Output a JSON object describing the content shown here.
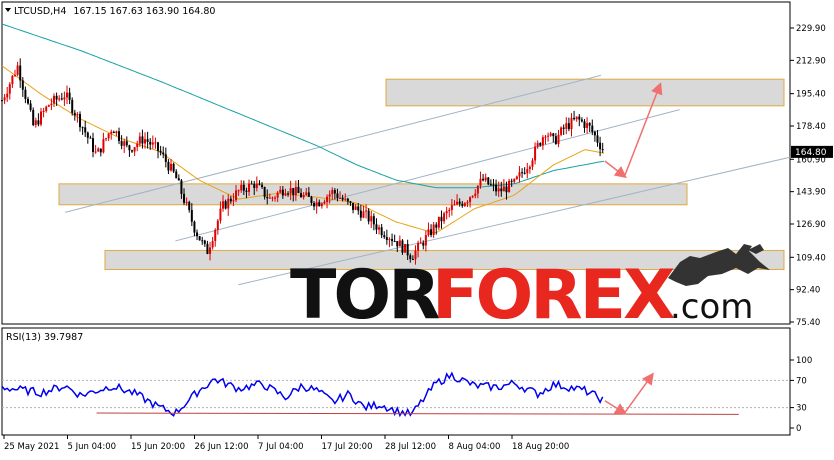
{
  "header": {
    "symbol": "LTCUSD,H4",
    "ohlc": "167.15 167.63 163.90 164.80"
  },
  "indicator": {
    "label": "RSI(13) 39.7987"
  },
  "watermark": {
    "tor": "TOR",
    "forex": "FOREX",
    "com": ".com"
  },
  "colors": {
    "bull": "#e00000",
    "bear": "#000000",
    "ma_fast": "#e8a317",
    "ma_slow": "#1aa3a3",
    "rsi": "#0000ee",
    "zone_fill": "#d9d9d9",
    "zone_border": "#e0a940",
    "channel": "#9fb4c8",
    "arrow": "#f07070",
    "tag": "#000000",
    "wm_dark": "#111111",
    "wm_red": "#e8281e"
  },
  "chart_data": [
    {
      "type": "candlestick",
      "symbol": "LTCUSD",
      "timeframe": "H4",
      "y_ticks": [
        229.9,
        212.9,
        195.4,
        178.4,
        160.9,
        143.9,
        126.9,
        109.4,
        92.4,
        75.4
      ],
      "ylim": [
        75.4,
        229.9
      ],
      "current_price": 164.8,
      "x_tick_labels": [
        "25 May 2021",
        "5 Jun 04:00",
        "15 Jun 20:00",
        "26 Jun 12:00",
        "7 Jul 04:00",
        "17 Jul 20:00",
        "28 Jul 12:00",
        "8 Aug 04:00",
        "18 Aug 20:00"
      ],
      "price_path": [
        [
          0,
          192
        ],
        [
          0.02,
          210
        ],
        [
          0.04,
          178
        ],
        [
          0.06,
          190
        ],
        [
          0.08,
          195
        ],
        [
          0.1,
          180
        ],
        [
          0.12,
          163
        ],
        [
          0.14,
          178
        ],
        [
          0.16,
          166
        ],
        [
          0.18,
          172
        ],
        [
          0.2,
          165
        ],
        [
          0.22,
          152
        ],
        [
          0.245,
          124
        ],
        [
          0.26,
          112
        ],
        [
          0.28,
          136
        ],
        [
          0.3,
          144
        ],
        [
          0.32,
          148
        ],
        [
          0.34,
          140
        ],
        [
          0.36,
          146
        ],
        [
          0.38,
          142
        ],
        [
          0.4,
          138
        ],
        [
          0.42,
          144
        ],
        [
          0.44,
          137
        ],
        [
          0.46,
          132
        ],
        [
          0.48,
          124
        ],
        [
          0.5,
          118
        ],
        [
          0.52,
          110
        ],
        [
          0.535,
          118
        ],
        [
          0.55,
          126
        ],
        [
          0.57,
          135
        ],
        [
          0.59,
          140
        ],
        [
          0.61,
          150
        ],
        [
          0.63,
          144
        ],
        [
          0.65,
          148
        ],
        [
          0.67,
          160
        ],
        [
          0.69,
          176
        ],
        [
          0.7,
          170
        ],
        [
          0.715,
          178
        ],
        [
          0.73,
          182
        ],
        [
          0.745,
          178
        ],
        [
          0.76,
          168
        ],
        [
          0.765,
          164.8
        ]
      ],
      "ma_fast_path": [
        [
          0,
          210
        ],
        [
          0.05,
          195
        ],
        [
          0.1,
          182
        ],
        [
          0.15,
          172
        ],
        [
          0.2,
          165
        ],
        [
          0.25,
          150
        ],
        [
          0.3,
          140
        ],
        [
          0.35,
          143
        ],
        [
          0.4,
          141
        ],
        [
          0.45,
          138
        ],
        [
          0.5,
          128
        ],
        [
          0.55,
          122
        ],
        [
          0.6,
          135
        ],
        [
          0.65,
          142
        ],
        [
          0.7,
          158
        ],
        [
          0.74,
          166
        ],
        [
          0.765,
          164
        ]
      ],
      "ma_slow_path": [
        [
          0,
          232
        ],
        [
          0.1,
          218
        ],
        [
          0.2,
          202
        ],
        [
          0.3,
          185
        ],
        [
          0.4,
          168
        ],
        [
          0.45,
          158
        ],
        [
          0.5,
          150
        ],
        [
          0.55,
          146
        ],
        [
          0.6,
          146
        ],
        [
          0.65,
          148
        ],
        [
          0.7,
          155
        ],
        [
          0.765,
          160
        ]
      ],
      "zones": [
        {
          "from": 189,
          "to": 203
        },
        {
          "from": 137,
          "to": 148
        },
        {
          "from": 103,
          "to": 113
        }
      ],
      "trendlines": [
        {
          "from": [
            0.08,
            133
          ],
          "to": [
            0.76,
            205
          ]
        },
        {
          "from": [
            0.22,
            118
          ],
          "to": [
            0.86,
            187
          ]
        },
        {
          "from": [
            0.3,
            95
          ],
          "to": [
            1.0,
            162
          ]
        }
      ],
      "forecast_arrows": [
        {
          "from": [
            0.765,
            160
          ],
          "to": [
            0.79,
            152
          ]
        },
        {
          "from": [
            0.79,
            152
          ],
          "to": [
            0.835,
            200
          ]
        }
      ]
    },
    {
      "type": "line",
      "name": "RSI(13)",
      "y_ticks": [
        100,
        70,
        30,
        0
      ],
      "ylim": [
        0,
        100
      ],
      "current_value": 39.7987,
      "rsi_path": [
        [
          0,
          60
        ],
        [
          0.05,
          52
        ],
        [
          0.08,
          62
        ],
        [
          0.1,
          48
        ],
        [
          0.14,
          62
        ],
        [
          0.17,
          50
        ],
        [
          0.2,
          30
        ],
        [
          0.22,
          22
        ],
        [
          0.25,
          55
        ],
        [
          0.27,
          72
        ],
        [
          0.3,
          58
        ],
        [
          0.33,
          65
        ],
        [
          0.36,
          45
        ],
        [
          0.38,
          62
        ],
        [
          0.4,
          55
        ],
        [
          0.42,
          38
        ],
        [
          0.44,
          50
        ],
        [
          0.46,
          30
        ],
        [
          0.48,
          35
        ],
        [
          0.5,
          25
        ],
        [
          0.52,
          20
        ],
        [
          0.55,
          65
        ],
        [
          0.57,
          78
        ],
        [
          0.6,
          62
        ],
        [
          0.63,
          60
        ],
        [
          0.65,
          66
        ],
        [
          0.68,
          50
        ],
        [
          0.7,
          64
        ],
        [
          0.72,
          60
        ],
        [
          0.74,
          55
        ],
        [
          0.765,
          40
        ]
      ],
      "support_line": {
        "from": [
          0.12,
          22
        ],
        "to": [
          0.935,
          20
        ]
      },
      "forecast_arrows": [
        {
          "from": [
            0.765,
            40
          ],
          "to": [
            0.79,
            22
          ]
        },
        {
          "from": [
            0.79,
            22
          ],
          "to": [
            0.825,
            78
          ]
        }
      ]
    }
  ]
}
